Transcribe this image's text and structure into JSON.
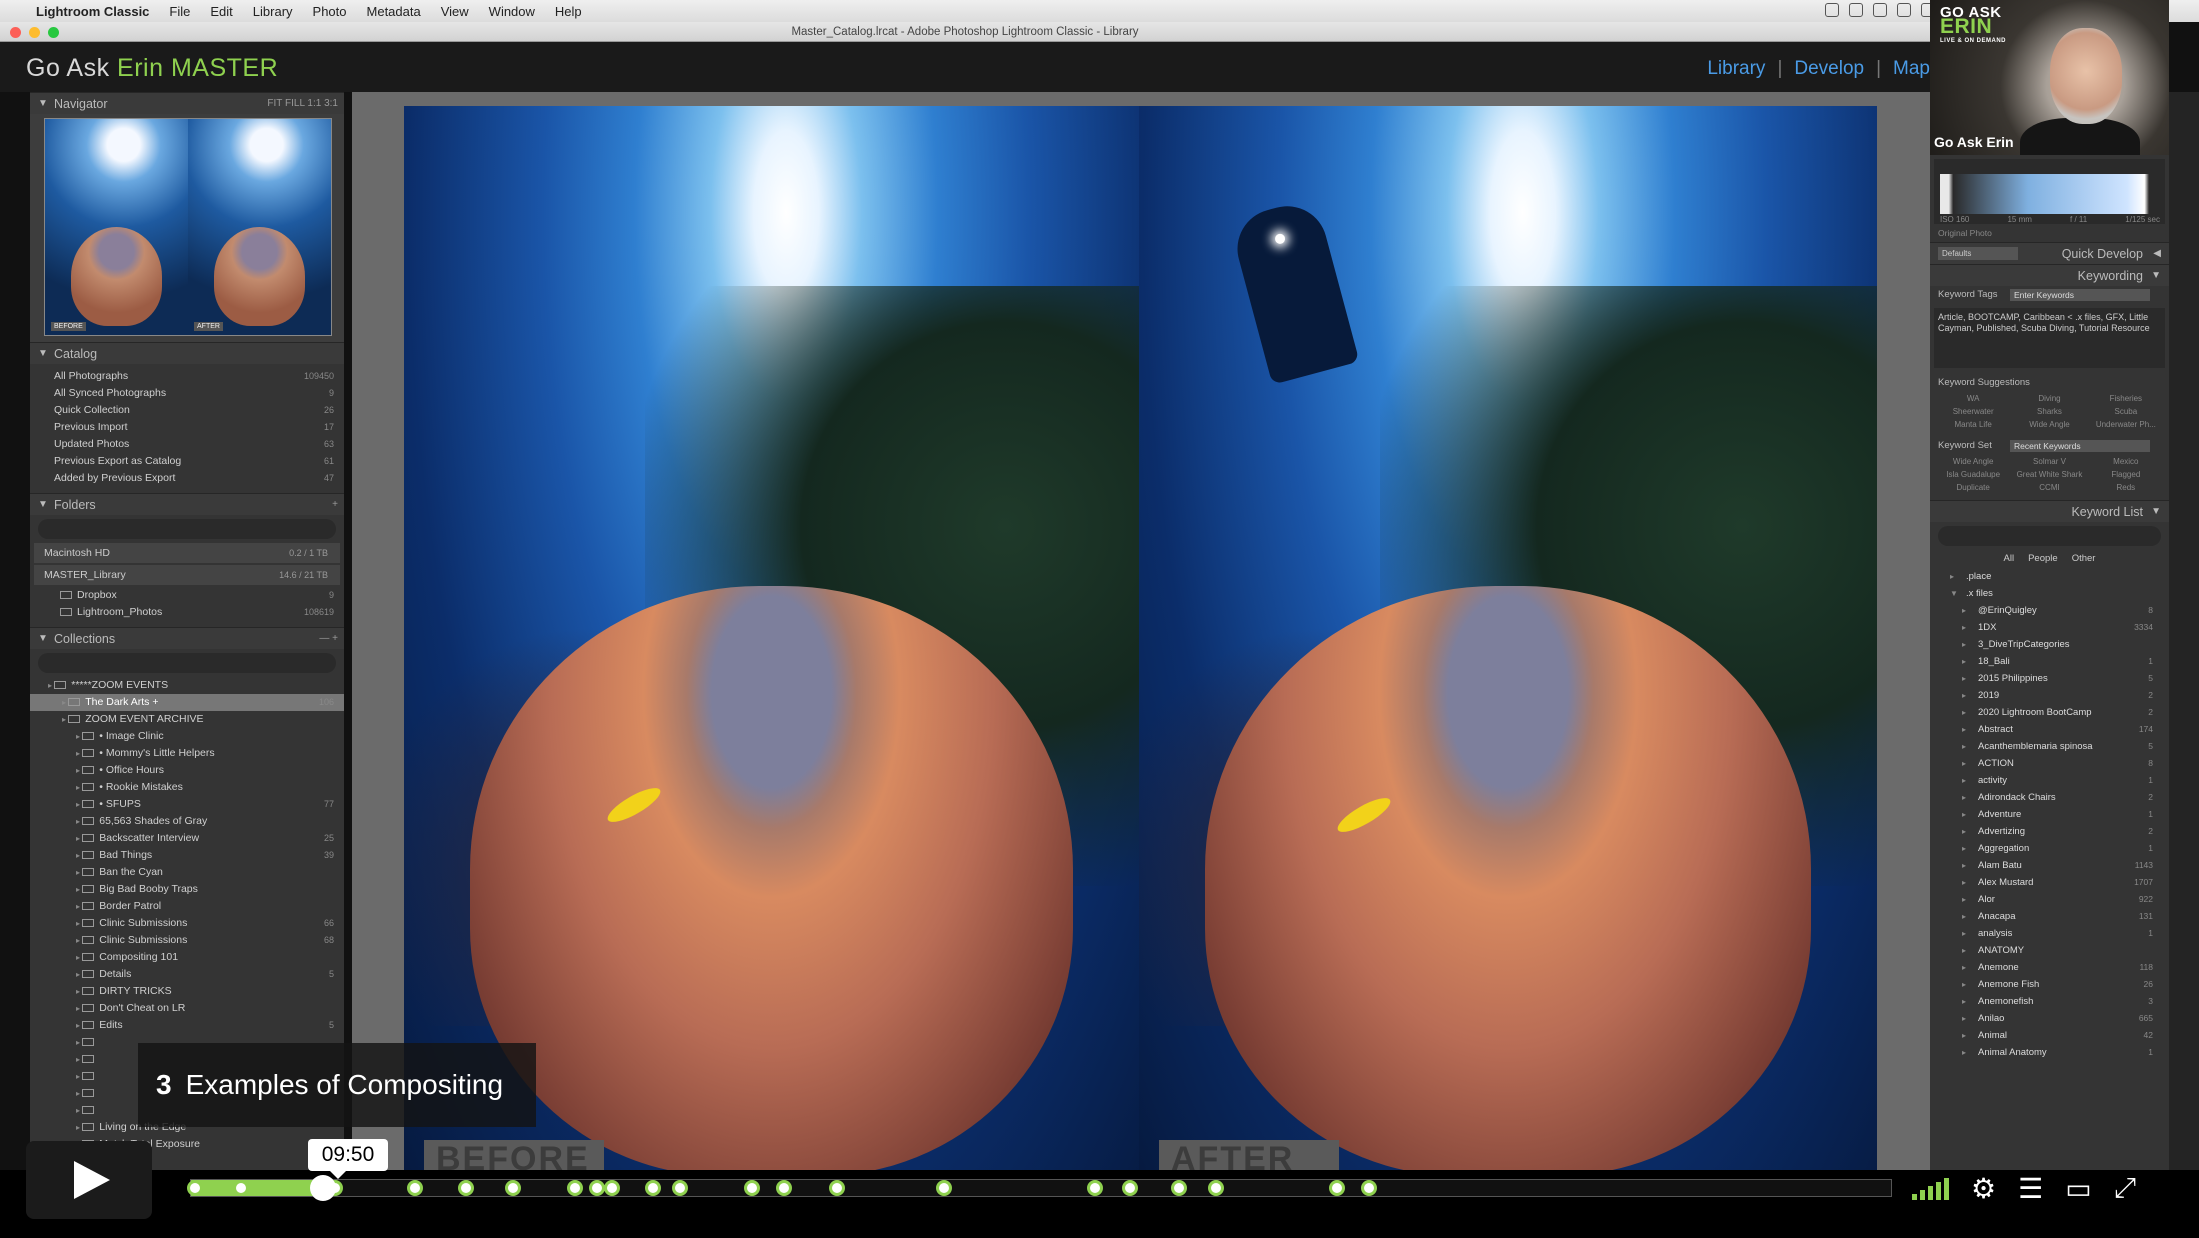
{
  "menubar": {
    "app": "Lightroom Classic",
    "items": [
      "File",
      "Edit",
      "Library",
      "Photo",
      "Metadata",
      "View",
      "Window",
      "Help"
    ]
  },
  "window": {
    "title": "Master_Catalog.lrcat - Adobe Photoshop Lightroom Classic - Library"
  },
  "identity": {
    "prefix": "Go Ask ",
    "name": "Erin MASTER"
  },
  "modules": {
    "library": "Library",
    "develop": "Develop",
    "map": "Map",
    "sep": "|"
  },
  "navigator": {
    "title": "Navigator",
    "zoom": "FIT FILL 1:1 3:1",
    "before": "BEFORE",
    "after": "AFTER"
  },
  "catalog": {
    "title": "Catalog",
    "items": [
      {
        "label": "All Photographs",
        "count": "109450"
      },
      {
        "label": "All Synced Photographs",
        "count": "9"
      },
      {
        "label": "Quick Collection",
        "count": "26"
      },
      {
        "label": "Previous Import",
        "count": "17"
      },
      {
        "label": "Updated Photos",
        "count": "63"
      },
      {
        "label": "Previous Export as Catalog",
        "count": "61"
      },
      {
        "label": "Added by Previous Export",
        "count": "47"
      }
    ]
  },
  "folders": {
    "title": "Folders",
    "volumes": [
      {
        "label": "Macintosh HD",
        "count": "0.2 / 1 TB"
      },
      {
        "label": "MASTER_Library",
        "count": "14.6 / 21 TB"
      }
    ],
    "items": [
      {
        "label": "Dropbox",
        "count": "9"
      },
      {
        "label": "Lightroom_Photos",
        "count": "108619"
      }
    ]
  },
  "collections": {
    "title": "Collections",
    "items": [
      {
        "label": "*****ZOOM EVENTS",
        "count": "",
        "indent": 1
      },
      {
        "label": "The Dark Arts +",
        "count": "106",
        "indent": 2,
        "selected": true
      },
      {
        "label": "ZOOM EVENT ARCHIVE",
        "count": "",
        "indent": 2
      },
      {
        "label": "• Image Clinic",
        "count": "",
        "indent": 3
      },
      {
        "label": "• Mommy's Little Helpers",
        "count": "",
        "indent": 3
      },
      {
        "label": "• Office Hours",
        "count": "",
        "indent": 3
      },
      {
        "label": "• Rookie Mistakes",
        "count": "",
        "indent": 3
      },
      {
        "label": "• SFUPS",
        "count": "77",
        "indent": 3
      },
      {
        "label": "65,563 Shades of Gray",
        "count": "",
        "indent": 3
      },
      {
        "label": "Backscatter Interview",
        "count": "25",
        "indent": 3
      },
      {
        "label": "Bad Things",
        "count": "39",
        "indent": 3
      },
      {
        "label": "Ban the Cyan",
        "count": "",
        "indent": 3
      },
      {
        "label": "Big Bad Booby Traps",
        "count": "",
        "indent": 3
      },
      {
        "label": "Border Patrol",
        "count": "",
        "indent": 3
      },
      {
        "label": "Clinic Submissions",
        "count": "66",
        "indent": 3
      },
      {
        "label": "Clinic Submissions",
        "count": "68",
        "indent": 3
      },
      {
        "label": "Compositing 101",
        "count": "",
        "indent": 3
      },
      {
        "label": "Details",
        "count": "5",
        "indent": 3
      },
      {
        "label": "DIRTY TRICKS",
        "count": "",
        "indent": 3
      },
      {
        "label": "Don't Cheat on LR",
        "count": "",
        "indent": 3
      },
      {
        "label": "Edits",
        "count": "5",
        "indent": 3
      },
      {
        "label": "",
        "count": "",
        "indent": 3
      },
      {
        "label": "",
        "count": "",
        "indent": 3
      },
      {
        "label": "",
        "count": "",
        "indent": 3
      },
      {
        "label": "",
        "count": "",
        "indent": 3
      },
      {
        "label": "",
        "count": "",
        "indent": 3
      },
      {
        "label": "Living on the Edge",
        "count": "",
        "indent": 3
      },
      {
        "label": "Match Total Exposure",
        "count": "",
        "indent": 3
      }
    ]
  },
  "photos": {
    "before": "BEFORE",
    "after": "AFTER"
  },
  "webcam": {
    "logo_top": "GO ASK",
    "logo_name": "ERIN",
    "logo_sub": "LIVE & ON DEMAND",
    "name": "Go Ask Erin"
  },
  "histogram": {
    "iso": "ISO 160",
    "focal": "15 mm",
    "aperture": "f / 11",
    "shutter": "1/125 sec",
    "original": "Original Photo"
  },
  "quickdevelop": {
    "title": "Quick Develop",
    "preset": "Defaults"
  },
  "keywording": {
    "title": "Keywording",
    "tags_label": "Keyword Tags",
    "tags_input": "Enter Keywords",
    "tags_text": "Article, BOOTCAMP, Caribbean < .x files, GFX, Little Cayman, Published, Scuba Diving, Tutorial Resource",
    "suggestions_label": "Keyword Suggestions",
    "suggestions": [
      "WA",
      "Diving",
      "Fisheries",
      "Sheerwater",
      "Sharks",
      "Scuba",
      "Manta Life",
      "Wide Angle",
      "Underwater Ph..."
    ],
    "set_label": "Keyword Set",
    "set_value": "Recent Keywords",
    "set_items": [
      "Wide Angle",
      "Solmar V",
      "Mexico",
      "Isla Guadalupe",
      "Great White Shark",
      "Flagged",
      "Duplicate",
      "CCMI",
      "Reds"
    ]
  },
  "keywordlist": {
    "title": "Keyword List",
    "tabs": [
      "All",
      "People",
      "Other"
    ],
    "items": [
      {
        "label": ".place",
        "count": ""
      },
      {
        "label": ".x files",
        "count": ""
      },
      {
        "label": "@ErinQuigley",
        "count": "8"
      },
      {
        "label": "1DX",
        "count": "3334"
      },
      {
        "label": "3_DiveTripCategories",
        "count": ""
      },
      {
        "label": "18_Bali",
        "count": "1"
      },
      {
        "label": "2015 Philippines",
        "count": "5"
      },
      {
        "label": "2019",
        "count": "2"
      },
      {
        "label": "2020 Lightroom BootCamp",
        "count": "2"
      },
      {
        "label": "Abstract",
        "count": "174"
      },
      {
        "label": "Acanthemblemaria spinosa",
        "count": "5"
      },
      {
        "label": "ACTION",
        "count": "8"
      },
      {
        "label": "activity",
        "count": "1"
      },
      {
        "label": "Adirondack Chairs",
        "count": "2"
      },
      {
        "label": "Adventure",
        "count": "1"
      },
      {
        "label": "Advertizing",
        "count": "2"
      },
      {
        "label": "Aggregation",
        "count": "1"
      },
      {
        "label": "Alam Batu",
        "count": "1143"
      },
      {
        "label": "Alex Mustard",
        "count": "1707"
      },
      {
        "label": "Alor",
        "count": "922"
      },
      {
        "label": "Anacapa",
        "count": "131"
      },
      {
        "label": "analysis",
        "count": "1"
      },
      {
        "label": "ANATOMY",
        "count": ""
      },
      {
        "label": "Anemone",
        "count": "118"
      },
      {
        "label": "Anemone Fish",
        "count": "26"
      },
      {
        "label": "Anemonefish",
        "count": "3"
      },
      {
        "label": "Anilao",
        "count": "665"
      },
      {
        "label": "Animal",
        "count": "42"
      },
      {
        "label": "Animal Anatomy",
        "count": "1"
      }
    ]
  },
  "player": {
    "chapter_num": "3",
    "chapter_title": "Examples of Compositing",
    "time": "09:50",
    "progress": 0.078,
    "chapters": [
      0.003,
      0.03,
      0.078,
      0.085,
      0.132,
      0.162,
      0.19,
      0.226,
      0.239,
      0.248,
      0.272,
      0.288,
      0.33,
      0.349,
      0.38,
      0.443,
      0.532,
      0.552,
      0.581,
      0.603,
      0.674,
      0.693
    ]
  }
}
